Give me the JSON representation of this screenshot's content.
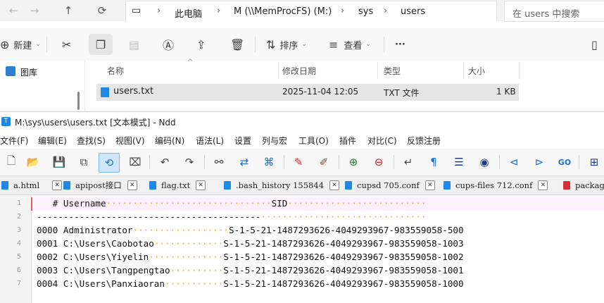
{
  "explorer": {
    "breadcrumb": [
      "此电脑",
      "M (\\\\MemProcFS) (M:)",
      "sys",
      "users"
    ],
    "search_placeholder": "在 users 中搜索",
    "ribbon": {
      "new": "新建",
      "sort": "排序",
      "view": "查看",
      "more": "···"
    },
    "nav_items": [
      "图库"
    ],
    "columns": [
      "名称",
      "修改日期",
      "类型",
      "大小"
    ],
    "files": [
      {
        "name": "users.txt",
        "modified": "2025-11-04 12:05",
        "type": "TXT 文件",
        "size": "1 KB"
      }
    ]
  },
  "ndd": {
    "app_icon_letter": "T",
    "title": "M:\\sys\\users\\users.txt [文本模式] - Ndd",
    "menu": [
      "文件(F)",
      "编辑(E)",
      "查找(S)",
      "视图(V)",
      "编码(N)",
      "语法(L)",
      "设置",
      "列与宏",
      "工具(O)",
      "插件",
      "对比(C)",
      "反馈注册"
    ],
    "tabs": [
      "a.html",
      "apipost接口",
      "flag.txt",
      ".bash_history 155844",
      "cupsd 705.conf",
      "cups-files 712.conf",
      "package"
    ],
    "line_numbers": [
      "1",
      "2",
      "3",
      "4",
      "5",
      "6",
      "7"
    ],
    "lines": [
      {
        "a": "   # Username",
        "b": "SID"
      },
      {
        "a": "------------------------------------------",
        "b": ""
      },
      {
        "a": "0000 Administrator",
        "b": "S-1-5-21-1487293626-4049293967-983559058-500"
      },
      {
        "a": "0001 C:\\Users\\Caobotao",
        "b": "S-1-5-21-1487293626-4049293967-983559058-1003"
      },
      {
        "a": "0002 C:\\Users\\Yiyelin",
        "b": "S-1-5-21-1487293626-4049293967-983559058-1002"
      },
      {
        "a": "0003 C:\\Users\\Tangpengtao",
        "b": "S-1-5-21-1487293626-4049293967-983559058-1001"
      },
      {
        "a": "0004 C:\\Users\\Panxiaoran",
        "b": "S-1-5-21-1487293626-4049293967-983559058-1000"
      }
    ]
  }
}
